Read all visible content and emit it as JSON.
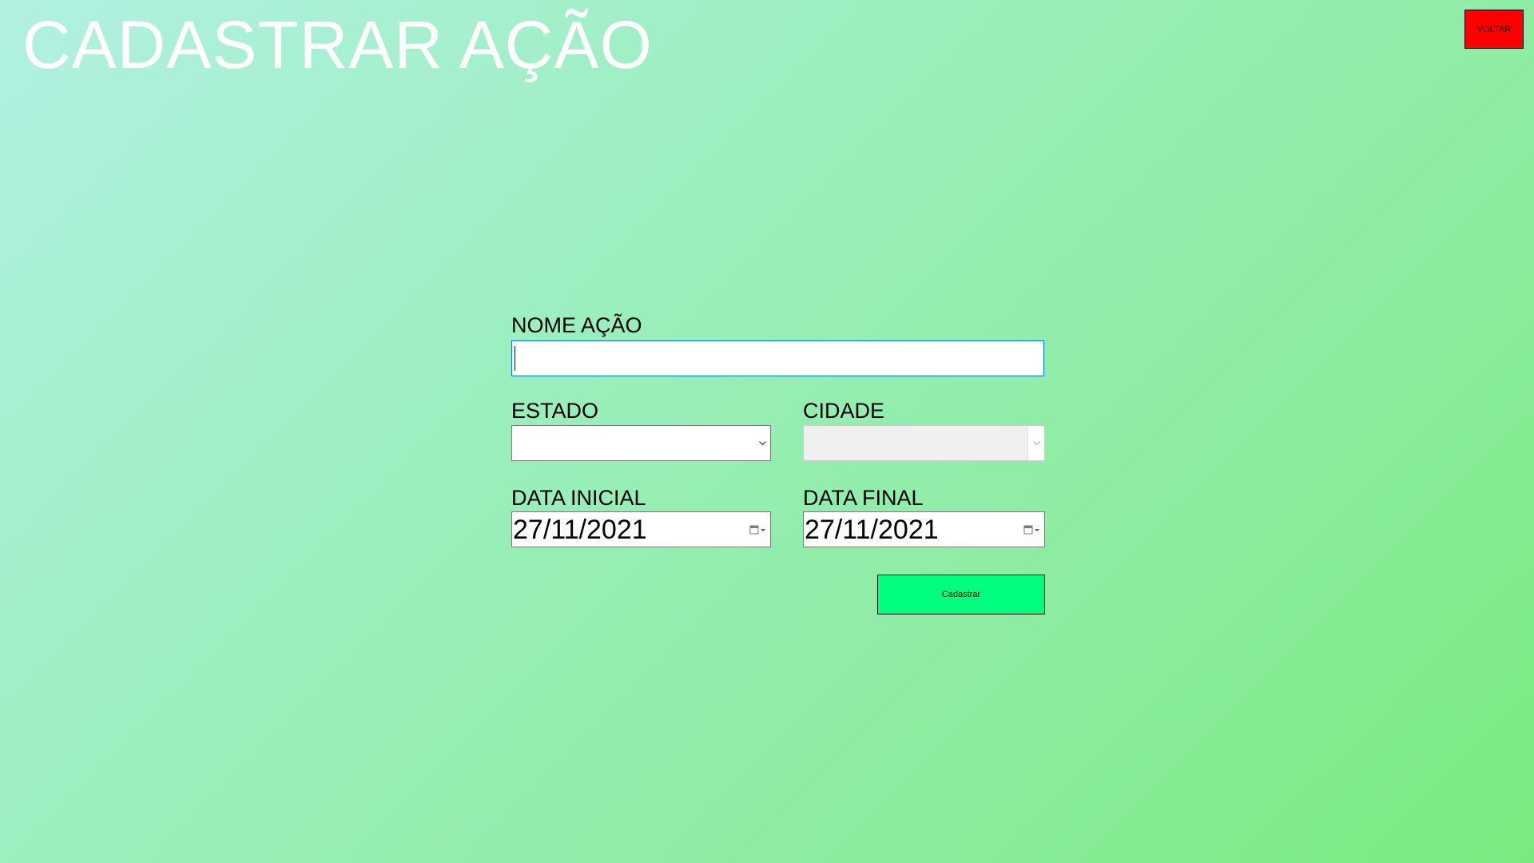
{
  "page": {
    "title": "CADASTRAR AÇÃO"
  },
  "header": {
    "back_label": "VOLTAR"
  },
  "form": {
    "nome_label": "NOME AÇÃO",
    "nome_value": "",
    "estado_label": "ESTADO",
    "estado_value": "",
    "cidade_label": "CIDADE",
    "cidade_value": "",
    "data_inicial_label": "DATA INICIAL",
    "data_inicial_value": "27/11/2021",
    "data_final_label": "DATA FINAL",
    "data_final_value": "27/11/2021",
    "submit_label": "Cadastrar"
  },
  "icons": {
    "dropdown": "chevron-down-icon",
    "calendar": "calendar-icon"
  },
  "colors": {
    "gradient_start": "#b2f0e2",
    "gradient_end": "#7aea80",
    "back_button": "#ff0000",
    "submit_button": "#00ff7f",
    "input_focus_border": "#0078d7"
  }
}
